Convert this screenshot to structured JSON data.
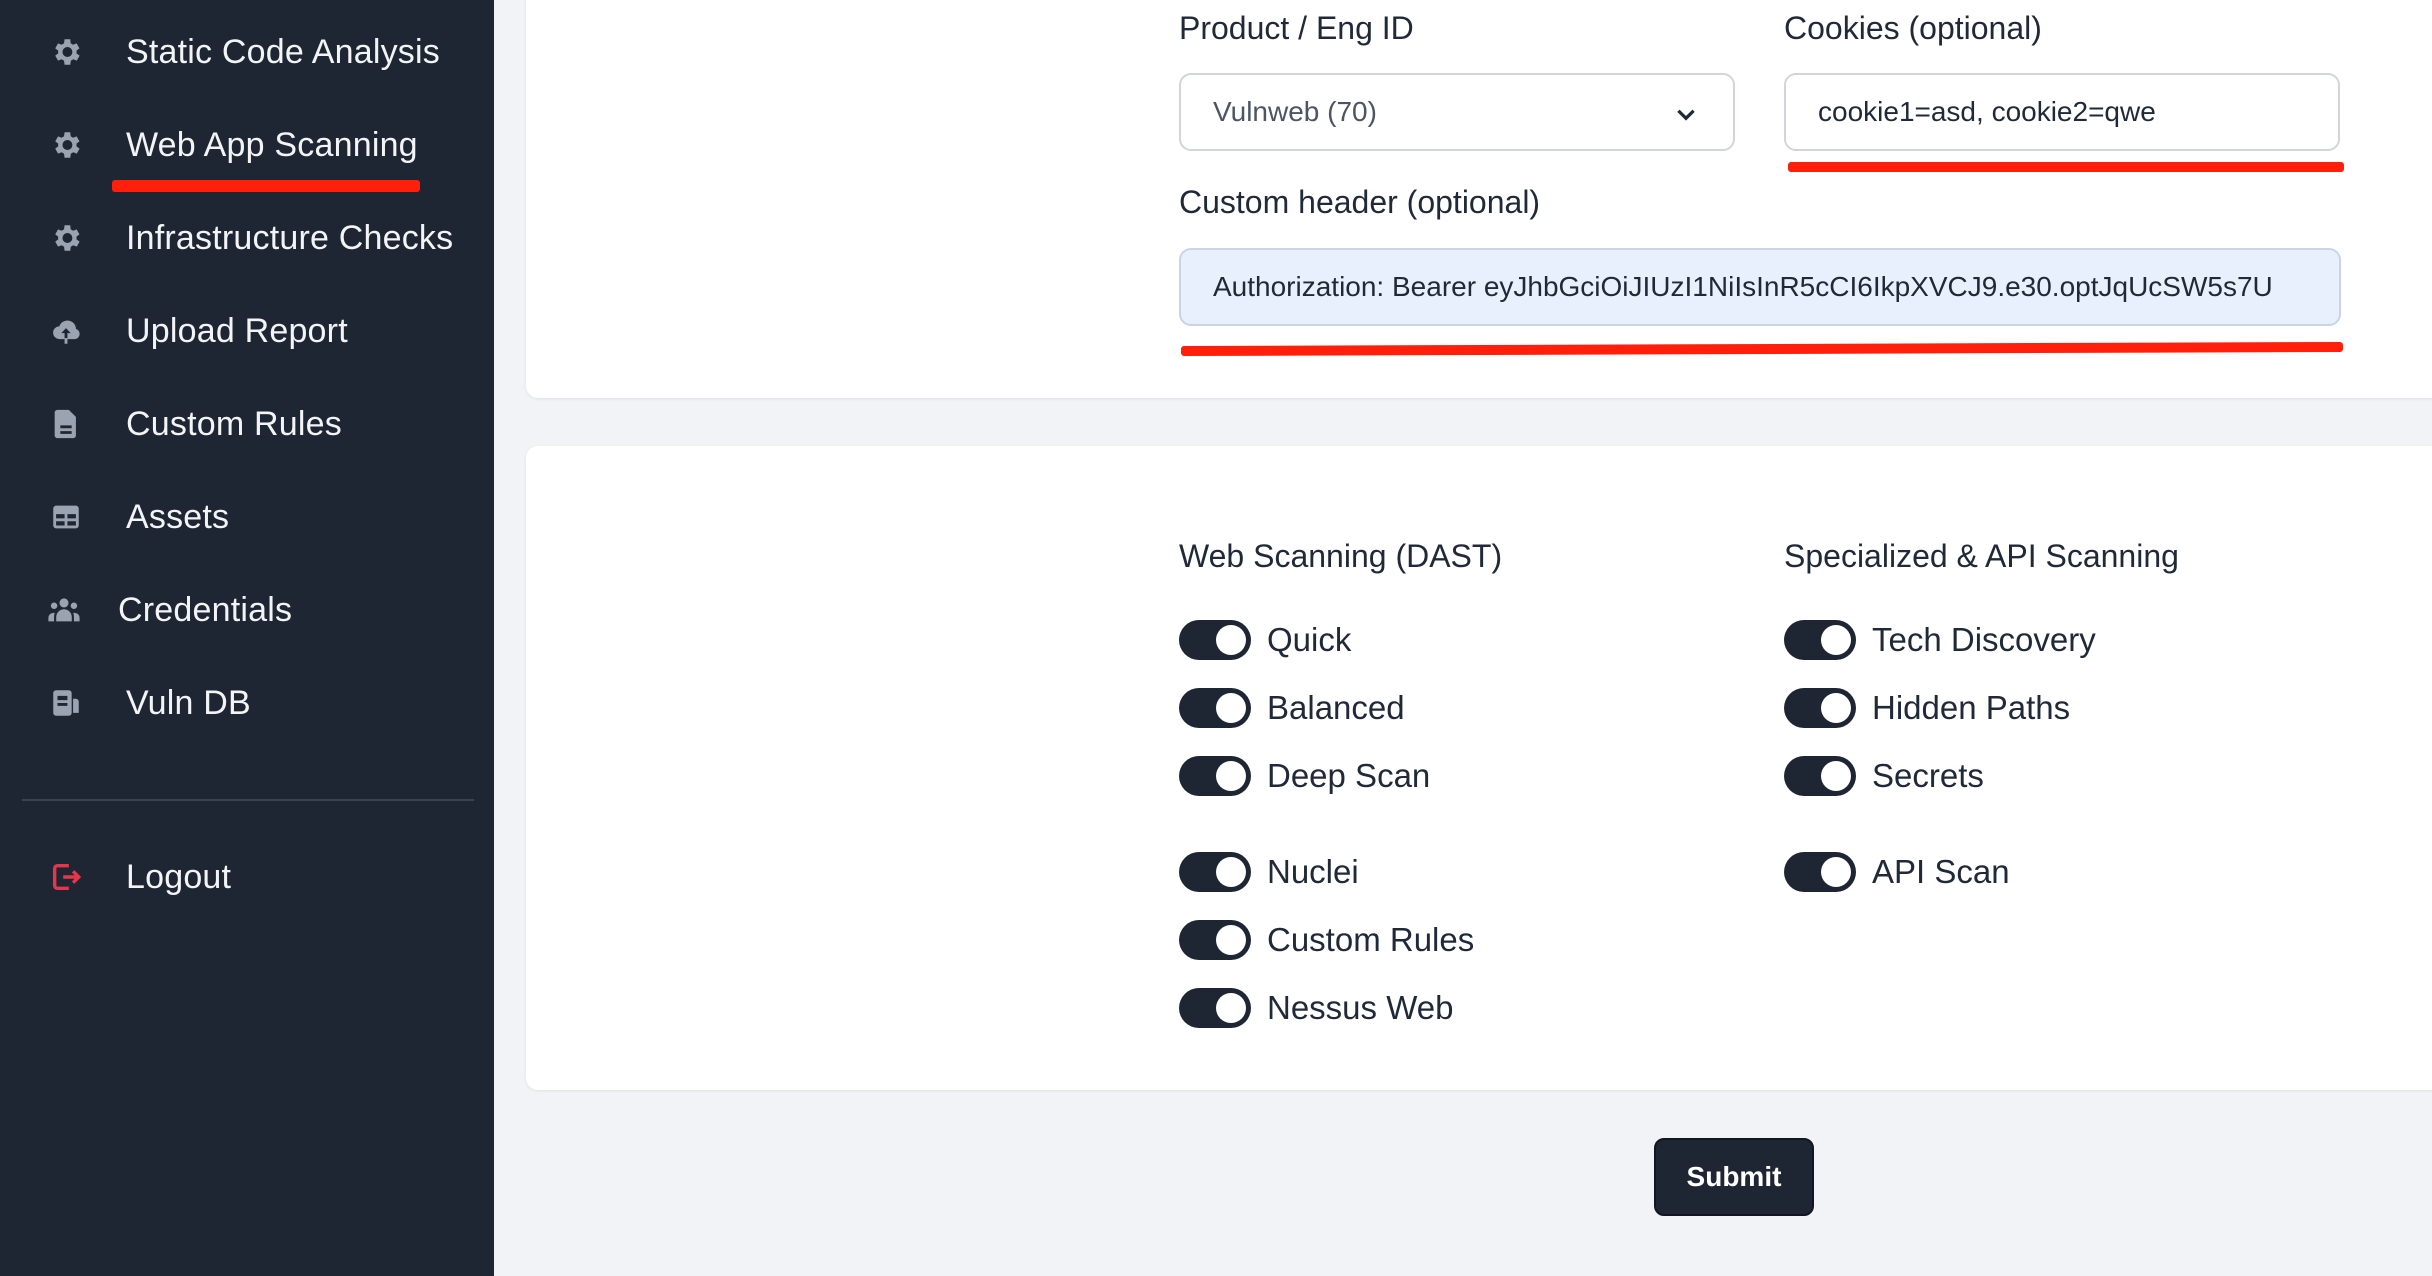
{
  "sidebar": {
    "items": [
      {
        "label": "Static Code Analysis",
        "icon": "gear-icon"
      },
      {
        "label": "Web App Scanning",
        "icon": "gear-icon"
      },
      {
        "label": "Infrastructure Checks",
        "icon": "gear-icon"
      },
      {
        "label": "Upload Report",
        "icon": "cloud-upload-icon"
      },
      {
        "label": "Custom Rules",
        "icon": "document-icon"
      },
      {
        "label": "Assets",
        "icon": "table-icon"
      },
      {
        "label": "Credentials",
        "icon": "users-icon"
      },
      {
        "label": "Vuln DB",
        "icon": "database-icon"
      }
    ],
    "logout": {
      "label": "Logout",
      "icon": "logout-icon"
    }
  },
  "form": {
    "product": {
      "label": "Product / Eng ID",
      "value": "Vulnweb (70)"
    },
    "cookies": {
      "label": "Cookies (optional)",
      "value": "cookie1=asd, cookie2=qwe"
    },
    "header": {
      "label": "Custom header (optional)",
      "value": "Authorization: Bearer eyJhbGciOiJIUzI1NiIsInR5cCI6IkpXVCJ9.e30.optJqUcSW5s7U"
    }
  },
  "scans": {
    "dast": {
      "title": "Web Scanning (DAST)",
      "items": [
        {
          "label": "Quick",
          "on": true
        },
        {
          "label": "Balanced",
          "on": true
        },
        {
          "label": "Deep Scan",
          "on": true
        },
        {
          "label": "Nuclei",
          "on": true
        },
        {
          "label": "Custom Rules",
          "on": true
        },
        {
          "label": "Nessus Web",
          "on": true
        }
      ]
    },
    "api": {
      "title": "Specialized & API Scanning",
      "items": [
        {
          "label": "Tech Discovery",
          "on": true
        },
        {
          "label": "Hidden Paths",
          "on": true
        },
        {
          "label": "Secrets",
          "on": true
        },
        {
          "label": "API Scan",
          "on": true
        }
      ]
    }
  },
  "submit_label": "Submit",
  "colors": {
    "sidebar_bg": "#1f2633",
    "accent_dark": "#1f2633",
    "annotation_red": "#ff1f0a",
    "logout_red": "#e5364b"
  }
}
